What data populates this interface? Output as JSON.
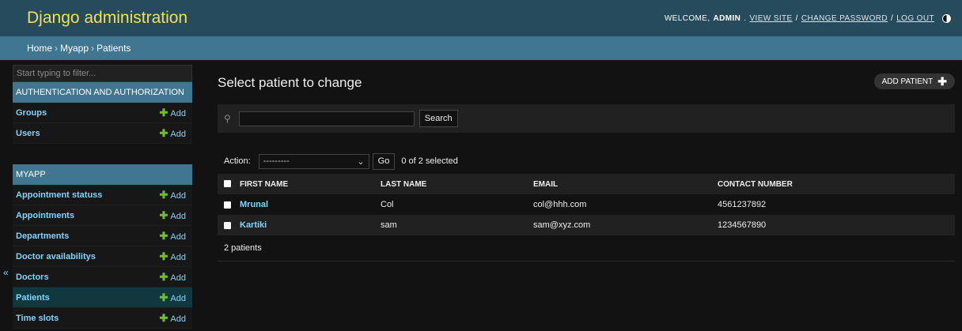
{
  "header": {
    "brand": "Django administration",
    "welcome": "Welcome,",
    "username": "admin",
    "view_site": "View site",
    "change_password": "Change password",
    "log_out": "Log out",
    "separator": "/"
  },
  "breadcrumbs": [
    "Home",
    "Myapp",
    "Patients"
  ],
  "sidebar": {
    "filter_placeholder": "Start typing to filter...",
    "apps": [
      {
        "caption": "Authentication and Authorization",
        "models": [
          {
            "name": "Groups",
            "add": "Add"
          },
          {
            "name": "Users",
            "add": "Add"
          }
        ]
      },
      {
        "caption": "Myapp",
        "models": [
          {
            "name": "Appointment statuss",
            "add": "Add"
          },
          {
            "name": "Appointments",
            "add": "Add"
          },
          {
            "name": "Departments",
            "add": "Add"
          },
          {
            "name": "Doctor availabilitys",
            "add": "Add"
          },
          {
            "name": "Doctors",
            "add": "Add"
          },
          {
            "name": "Patients",
            "add": "Add",
            "current": true
          },
          {
            "name": "Time slots",
            "add": "Add"
          }
        ]
      }
    ],
    "toggle": "«"
  },
  "content": {
    "title": "Select patient to change",
    "add_button": "Add patient",
    "search_button": "Search",
    "search_value": "",
    "action_label": "Action:",
    "action_selected": "---------",
    "go_button": "Go",
    "selection_counter": "0 of 2 selected",
    "columns": [
      "First name",
      "Last name",
      "Email",
      "Contact number"
    ],
    "rows": [
      {
        "first_name": "Mrunal",
        "last_name": "Col",
        "email": "col@hhh.com",
        "contact": "4561237892"
      },
      {
        "first_name": "Kartiki",
        "last_name": "sam",
        "email": "sam@xyz.com",
        "contact": "1234567890"
      }
    ],
    "paginator": "2 patients"
  },
  "colors": {
    "header_bg": "#264b5d",
    "brand": "#f5dd5d",
    "accent": "#417690",
    "link": "#81d4fa",
    "add_plus": "#70bf2b",
    "body_bg": "#121212"
  },
  "icons": {
    "theme": "theme-toggle-icon",
    "search": "search-icon",
    "add": "plus-icon",
    "dropdown": "chevron-down-icon"
  }
}
